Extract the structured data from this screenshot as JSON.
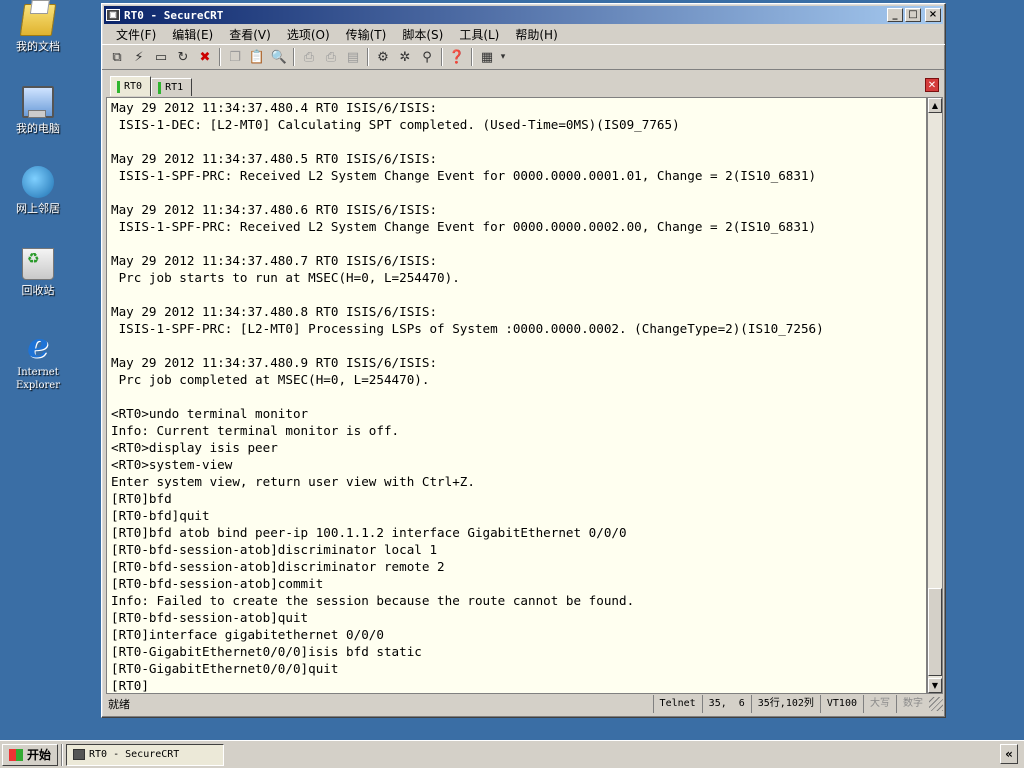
{
  "desktop": {
    "icons": [
      {
        "label": "我的文档",
        "icon": "my-documents-icon"
      },
      {
        "label": "我的电脑",
        "icon": "my-computer-icon"
      },
      {
        "label": "网上邻居",
        "icon": "network-places-icon"
      },
      {
        "label": "回收站",
        "icon": "recycle-bin-icon"
      },
      {
        "label": "Internet\nExplorer",
        "icon": "internet-explorer-icon"
      }
    ]
  },
  "window": {
    "title": "RT0 - SecureCRT",
    "buttons": {
      "minimize": "_",
      "maximize": "□",
      "close": "×"
    }
  },
  "menu": [
    "文件(F)",
    "编辑(E)",
    "查看(V)",
    "选项(O)",
    "传输(T)",
    "脚本(S)",
    "工具(L)",
    "帮助(H)"
  ],
  "tabs": [
    {
      "label": "RT0",
      "active": true
    },
    {
      "label": "RT1",
      "active": false
    }
  ],
  "terminal": {
    "lines": [
      "May 29 2012 11:34:37.480.4 RT0 ISIS/6/ISIS:",
      " ISIS-1-DEC: [L2-MT0] Calculating SPT completed. (Used-Time=0MS)(IS09_7765)",
      "",
      "May 29 2012 11:34:37.480.5 RT0 ISIS/6/ISIS:",
      " ISIS-1-SPF-PRC: Received L2 System Change Event for 0000.0000.0001.01, Change = 2(IS10_6831)",
      "",
      "May 29 2012 11:34:37.480.6 RT0 ISIS/6/ISIS:",
      " ISIS-1-SPF-PRC: Received L2 System Change Event for 0000.0000.0002.00, Change = 2(IS10_6831)",
      "",
      "May 29 2012 11:34:37.480.7 RT0 ISIS/6/ISIS:",
      " Prc job starts to run at MSEC(H=0, L=254470).",
      "",
      "May 29 2012 11:34:37.480.8 RT0 ISIS/6/ISIS:",
      " ISIS-1-SPF-PRC: [L2-MT0] Processing LSPs of System :0000.0000.0002. (ChangeType=2)(IS10_7256)",
      "",
      "May 29 2012 11:34:37.480.9 RT0 ISIS/6/ISIS:",
      " Prc job completed at MSEC(H=0, L=254470).",
      "",
      "<RT0>undo terminal monitor",
      "Info: Current terminal monitor is off.",
      "<RT0>display isis peer",
      "<RT0>system-view",
      "Enter system view, return user view with Ctrl+Z.",
      "[RT0]bfd",
      "[RT0-bfd]quit",
      "[RT0]bfd atob bind peer-ip 100.1.1.2 interface GigabitEthernet 0/0/0",
      "[RT0-bfd-session-atob]discriminator local 1",
      "[RT0-bfd-session-atob]discriminator remote 2",
      "[RT0-bfd-session-atob]commit",
      "Info: Failed to create the session because the route cannot be found.",
      "[RT0-bfd-session-atob]quit",
      "[RT0]interface gigabitethernet 0/0/0",
      "[RT0-GigabitEthernet0/0/0]isis bfd static",
      "[RT0-GigabitEthernet0/0/0]quit",
      "[RT0]"
    ]
  },
  "status": {
    "ready": "就绪",
    "protocol": "Telnet",
    "row": "35,",
    "col": "6",
    "size": "35行,102列",
    "term": "VT100",
    "caps": "大写",
    "num": "数字"
  },
  "taskbar": {
    "start": "开始",
    "task": "RT0 - SecureCRT",
    "tray": "«"
  }
}
